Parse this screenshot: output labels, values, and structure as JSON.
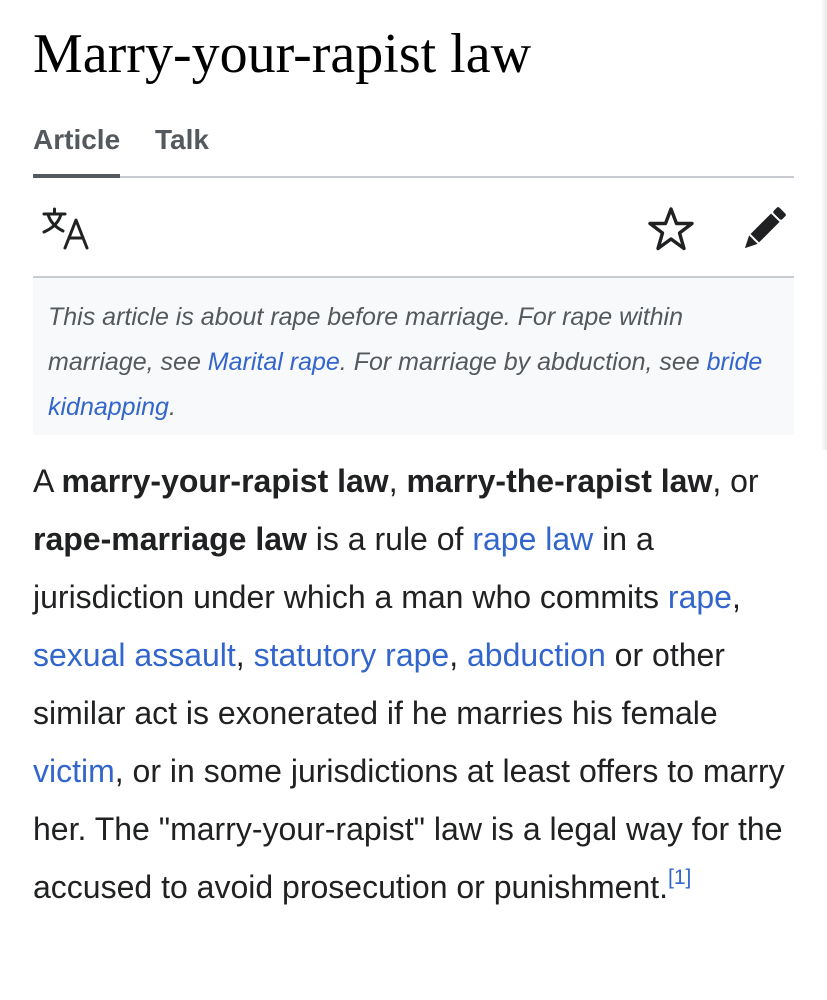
{
  "page": {
    "title": "Marry-your-rapist law"
  },
  "tabs": [
    {
      "label": "Article",
      "selected": true
    },
    {
      "label": "Talk",
      "selected": false
    }
  ],
  "toolbar": {
    "icons": [
      "language-icon",
      "watch-star-icon",
      "edit-pencil-icon"
    ]
  },
  "hatnote": {
    "part1": "This article is about rape before marriage. For rape within marriage, see ",
    "link1": "Marital rape",
    "part2": ". For marriage by abduction, see ",
    "link2": "bride kidnapping",
    "part3": "."
  },
  "intro": {
    "t1": "A ",
    "b1": "marry-your-rapist law",
    "t2": ", ",
    "b2": "marry-the-rapist law",
    "t3": ", or ",
    "b3": "rape-marriage law",
    "t4": " is a rule of ",
    "l1": "rape law",
    "t5": " in a jurisdiction under which a man who commits ",
    "l2": "rape",
    "t6": ", ",
    "l3": "sexual assault",
    "t7": ", ",
    "l4": "statutory rape",
    "t8": ", ",
    "l5": "abduction",
    "t9": " or other similar act is exonerated if he marries his female ",
    "l6": "victim",
    "t10": ", or in some jurisdictions at least offers to marry her. The \"marry-your-rapist\" law is a legal way for the accused to avoid prosecution or punishment.",
    "ref": "[1]"
  },
  "colors": {
    "link": "#3366cc",
    "text": "#202122",
    "muted": "#54595d",
    "divider": "#c8ccd1",
    "hatnote_bg": "#f8f9fa"
  }
}
